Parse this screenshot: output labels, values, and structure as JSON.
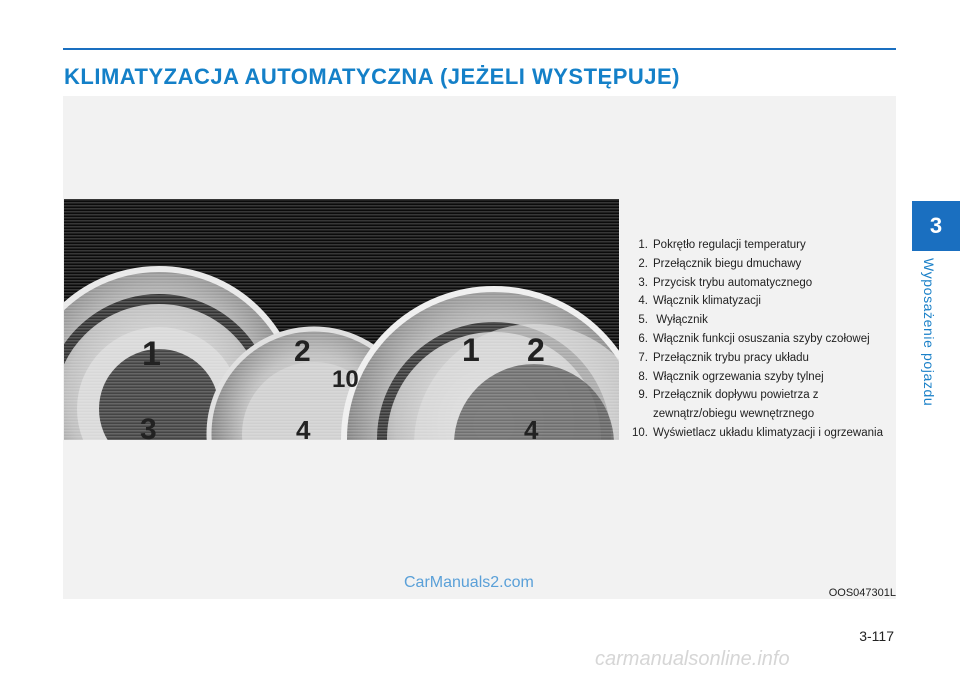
{
  "title": "KLIMATYZACJA AUTOMATYCZNA (JEŻELI WYSTĘPUJE)",
  "legend": [
    {
      "num": "1.",
      "text": "Pokrętło regulacji temperatury"
    },
    {
      "num": "2.",
      "text": "Przełącznik biegu dmuchawy"
    },
    {
      "num": "3.",
      "text": "Przycisk trybu automatycznego"
    },
    {
      "num": "4.",
      "text": "Włącznik klimatyzacji"
    },
    {
      "num": "5.",
      "text": " Wyłącznik"
    },
    {
      "num": "6.",
      "text": "Włącznik funkcji osuszania szyby czołowej"
    },
    {
      "num": "7.",
      "text": "Przełącznik trybu pracy układu"
    },
    {
      "num": "8.",
      "text": "Włącznik ogrzewania szyby tylnej"
    },
    {
      "num": "9.",
      "text": "Przełącznik dopływu powietrza z zewnątrz/obiegu wewnętrznego"
    },
    {
      "num": "10.",
      "text": "Wyświetlacz układu klimatyzacji i ogrzewania"
    }
  ],
  "figure_code": "OOS047301L",
  "watermark": "CarManuals2.com",
  "chapter": {
    "number": "3",
    "label": "Wyposażenie pojazdu"
  },
  "page_number": "3-117",
  "footer_watermark": "carmanualsonline.info",
  "photo_labels": {
    "n1": "1",
    "n2": "2",
    "n3": "3",
    "n4": "4",
    "n10": "10",
    "n1b": "1",
    "n2b": "2",
    "n4b": "4"
  },
  "colors": {
    "accent": "#1a6fc0",
    "title": "#1480c8"
  }
}
